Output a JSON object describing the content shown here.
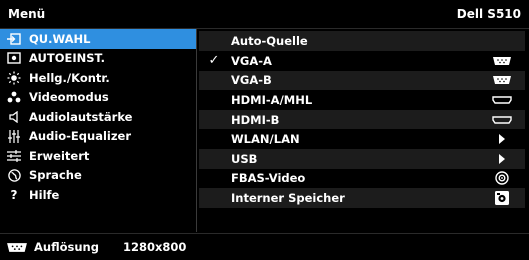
{
  "header": {
    "title": "Menü",
    "model": "Dell S510"
  },
  "sidebar": {
    "items": [
      {
        "label": "QU.WAHL",
        "icon": "input-source-icon",
        "active": true
      },
      {
        "label": "AUTOEINST.",
        "icon": "auto-adjust-icon",
        "active": false
      },
      {
        "label": "Hellg./Kontr.",
        "icon": "brightness-icon",
        "active": false
      },
      {
        "label": "Videomodus",
        "icon": "video-mode-icon",
        "active": false
      },
      {
        "label": "Audiolautstärke",
        "icon": "speaker-icon",
        "active": false
      },
      {
        "label": "Audio-Equalizer",
        "icon": "equalizer-icon",
        "active": false
      },
      {
        "label": "Erweitert",
        "icon": "advanced-settings-icon",
        "active": false
      },
      {
        "label": "Sprache",
        "icon": "globe-icon",
        "active": false
      },
      {
        "label": "Hilfe",
        "icon": "help-icon",
        "active": false
      }
    ]
  },
  "sources": {
    "header": "Auto-Quelle",
    "items": [
      {
        "label": "VGA-A",
        "checked": true,
        "icon": "vga-connector-icon"
      },
      {
        "label": "VGA-B",
        "checked": false,
        "icon": "vga-connector-icon"
      },
      {
        "label": "HDMI-A/MHL",
        "checked": false,
        "icon": "hdmi-connector-icon"
      },
      {
        "label": "HDMI-B",
        "checked": false,
        "icon": "hdmi-connector-icon"
      },
      {
        "label": "WLAN/LAN",
        "checked": false,
        "icon": "submenu-arrow-icon"
      },
      {
        "label": "USB",
        "checked": false,
        "icon": "submenu-arrow-icon"
      },
      {
        "label": "FBAS-Video",
        "checked": false,
        "icon": "composite-video-icon"
      },
      {
        "label": "Interner Speicher",
        "checked": false,
        "icon": "internal-storage-icon"
      }
    ],
    "check_glyph": "✓"
  },
  "footer": {
    "label": "Auflösung",
    "resolution": "1280x800",
    "icon": "vga-connector-icon"
  },
  "colors": {
    "accent": "#2f8fe0",
    "background": "#000000",
    "row_alt": "#1c1c1c"
  }
}
